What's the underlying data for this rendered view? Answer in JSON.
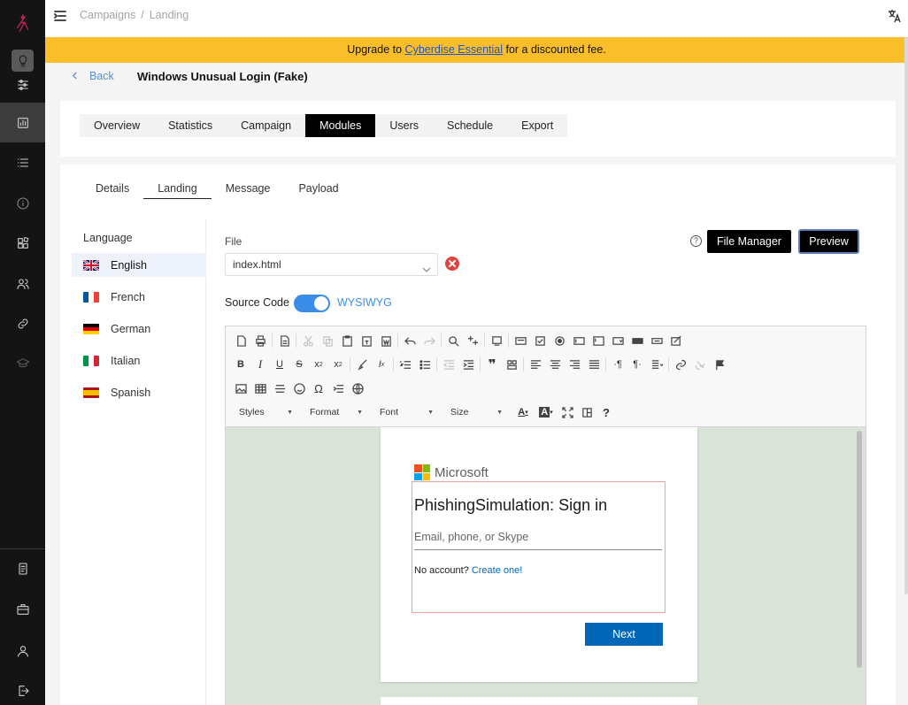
{
  "topbar": {
    "breadcrumb": [
      "Campaigns",
      "Landing"
    ],
    "breadcrumb_sep": "/"
  },
  "banner": {
    "prefix": "Upgrade to ",
    "link": "Cyberdise Essential",
    "suffix": " for a discounted fee."
  },
  "header": {
    "back_label": "Back",
    "title": "Windows Unusual Login (Fake)"
  },
  "main_tabs": [
    {
      "label": "Overview",
      "active": false
    },
    {
      "label": "Statistics",
      "active": false
    },
    {
      "label": "Campaign",
      "active": false
    },
    {
      "label": "Modules",
      "active": true
    },
    {
      "label": "Users",
      "active": false
    },
    {
      "label": "Schedule",
      "active": false
    },
    {
      "label": "Export",
      "active": false
    }
  ],
  "sub_tabs": [
    {
      "label": "Details",
      "active": false
    },
    {
      "label": "Landing",
      "active": true
    },
    {
      "label": "Message",
      "active": false
    },
    {
      "label": "Payload",
      "active": false
    }
  ],
  "languages": {
    "heading": "Language",
    "items": [
      {
        "label": "English",
        "flag": "gb",
        "active": true
      },
      {
        "label": "French",
        "flag": "fr",
        "active": false
      },
      {
        "label": "German",
        "flag": "de",
        "active": false
      },
      {
        "label": "Italian",
        "flag": "it",
        "active": false
      },
      {
        "label": "Spanish",
        "flag": "es",
        "active": false
      }
    ]
  },
  "file": {
    "label": "File",
    "value": "index.html"
  },
  "actions": {
    "help": "?",
    "file_manager": "File Manager",
    "preview": "Preview"
  },
  "source": {
    "label": "Source Code",
    "mode": "WYSIWYG",
    "enabled": true
  },
  "toolbar": {
    "styles": "Styles",
    "format": "Format",
    "font": "Font",
    "size": "Size",
    "help": "?"
  },
  "preview_page": {
    "brand": "Microsoft",
    "heading": "PhishingSimulation: Sign in",
    "input_placeholder": "Email, phone, or Skype",
    "no_account": "No account? ",
    "create_link": "Create one!",
    "next_button": "Next"
  },
  "colors": {
    "banner": "#fbbe2b",
    "accent": "#3b8ee8",
    "ms_blue": "#0067b8",
    "sidebar": "#141414"
  }
}
